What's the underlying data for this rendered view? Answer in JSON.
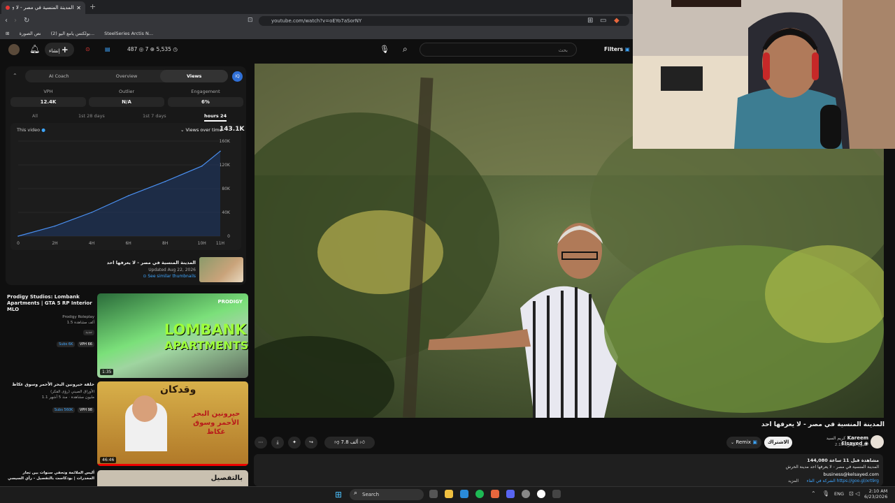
{
  "browser": {
    "tab_title": "المدينة المنسية في مصر - لا ي",
    "new_tab": "+",
    "url": "youtube.com/watch?v=oEYo7aSorNY",
    "bookmarks": [
      "نص الصورة",
      "(2) بولكتس يامع اليو...",
      "SteelSeries Arctis N..."
    ]
  },
  "yt": {
    "create_label": "إنشاء",
    "stat_a": "487",
    "stat_b": "7",
    "stat_c": "5,535",
    "search_placeholder": "بحث",
    "filters": "Filters"
  },
  "panel": {
    "tabs": [
      "AI Coach",
      "Overview",
      "Views"
    ],
    "metrics": [
      {
        "label": "VPH",
        "value": "12.4K"
      },
      {
        "label": "Outlier",
        "value": "N/A"
      },
      {
        "label": "Engagement",
        "value": "6%"
      }
    ],
    "ranges": [
      "All",
      "1st 28 days",
      "1st 7 days",
      "hours 24"
    ],
    "this_video": "This video",
    "views_over_time": "Views over time",
    "total": "143.1K",
    "video_title": "المدينة المنسية في مصر - لا يعرفها احد",
    "updated": "Updated Aug 22, 2026",
    "see_similar": "See similar thumbnails"
  },
  "chart_data": {
    "type": "line",
    "x": [
      "0",
      "2H",
      "4H",
      "6H",
      "8H",
      "10H",
      "11H"
    ],
    "x_values": [
      0,
      2,
      4,
      6,
      8,
      10,
      11
    ],
    "series": [
      {
        "values": [
          0,
          17,
          40,
          68,
          92,
          118,
          143
        ]
      }
    ],
    "yticks": [
      "160K",
      "120K",
      "80K",
      "40K",
      "0"
    ],
    "ylim": [
      0,
      160
    ],
    "xlim": [
      0,
      11
    ],
    "grid": true
  },
  "recs": [
    {
      "title": "Prodigy Studios: Lombank Apartments | GTA 5 RP Interior MLO",
      "channel": "Prodigy Roleplay",
      "meta": "1.5 ألف مشاهدة",
      "badge": "جديد",
      "subs": "Subs 6K",
      "vph": "VPH 66",
      "duration": "1:35",
      "thumb_text1": "LOMBANK",
      "thumb_text2": "APARTMENTS",
      "thumb_logo": "PRODIGY"
    },
    {
      "title": "حلقة حيرونين البحر الأحمر وسوق غكاظ",
      "channel": "الأوراق الصيني (رؤى الفكر)",
      "meta": "1.1 مليون مشاهدة · منذ 5 أشهر",
      "subs": "Subs 560K",
      "vph": "VPH 98",
      "duration": "46:46",
      "thumb_text1": "وقدكان",
      "thumb_text2": "حيرونين البحر الأحمر وسوق غكاظ"
    },
    {
      "title": "أليس الملائمة وتحفي سنوات بين تجار المخدرات | بودكاست بالتفصيل - رأي السيسي",
      "thumb_text1": "بالتفصيل"
    }
  ],
  "video": {
    "title": "المدينة المنسية في مصر - لا يعرفها احد",
    "channel": "Kareem Elsayed",
    "channel_ar": "كريم السيد",
    "subs": "2.15 مليون مشترك",
    "subscribe": "الاشتراك",
    "remix": "Remix",
    "likes": "7.8 ألف",
    "views": "144,080 مشاهدة قبل 11 ساعة",
    "desc1": "المدينة المنسية في مصر - لا يعرفها احد مدينة الحرش",
    "email": "business@kelsayed.com",
    "link": "الشركة في الفاء https://goo.gl/xrt9rg",
    "more": "المزيد"
  },
  "taskbar": {
    "search": "Search",
    "lang": "ENG",
    "time": "2:10 AM",
    "date": "6/23/2026"
  }
}
